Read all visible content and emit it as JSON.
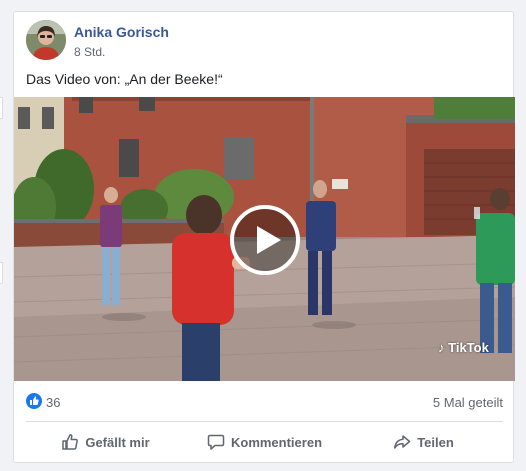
{
  "post": {
    "author": "Anika Gorisch",
    "time": "8 Std.",
    "caption": "Das Video von: „An der Beeke!“"
  },
  "video": {
    "watermark": "TikTok",
    "play_icon": "play-icon"
  },
  "stats": {
    "likes": "36",
    "shares": "5 Mal geteilt"
  },
  "actions": {
    "like": "Gefällt mir",
    "comment": "Kommentieren",
    "share": "Teilen"
  },
  "colors": {
    "accent": "#1877f2",
    "author": "#385898",
    "muted": "#606770"
  }
}
